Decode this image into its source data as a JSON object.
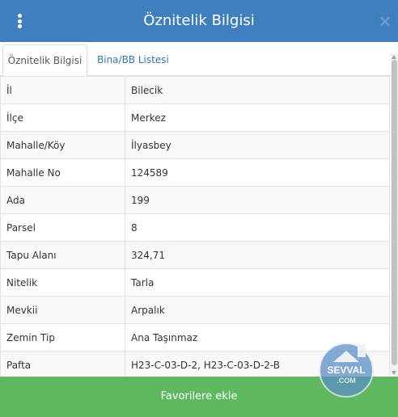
{
  "header": {
    "title": "Öznitelik Bilgisi",
    "close_symbol": "×",
    "menu_icon": "vertical-dots-icon"
  },
  "tabs": [
    {
      "label": "Öznitelik Bilgisi",
      "active": true
    },
    {
      "label": "Bina/BB Listesi",
      "active": false
    }
  ],
  "attributes": [
    {
      "key": "İl",
      "value": "Bilecik"
    },
    {
      "key": "İlçe",
      "value": "Merkez"
    },
    {
      "key": "Mahalle/Köy",
      "value": "İlyasbey"
    },
    {
      "key": "Mahalle No",
      "value": "124589"
    },
    {
      "key": "Ada",
      "value": "199"
    },
    {
      "key": "Parsel",
      "value": "8"
    },
    {
      "key": "Tapu Alanı",
      "value": "324,71"
    },
    {
      "key": "Nitelik",
      "value": "Tarla"
    },
    {
      "key": "Mevkii",
      "value": "Arpalık"
    },
    {
      "key": "Zemin Tip",
      "value": "Ana Taşınmaz"
    },
    {
      "key": "Pafta",
      "value": "H23-C-03-D-2, H23-C-03-D-2-B"
    }
  ],
  "footer": {
    "favorite_label": "Favorilere ekle"
  },
  "watermark": {
    "text_line1": "SEVVAL",
    "text_line2": ".COM"
  },
  "colors": {
    "header_bg": "#3f7fc0",
    "tab_link": "#3a72b0",
    "favorite_bg": "#5fb760"
  }
}
